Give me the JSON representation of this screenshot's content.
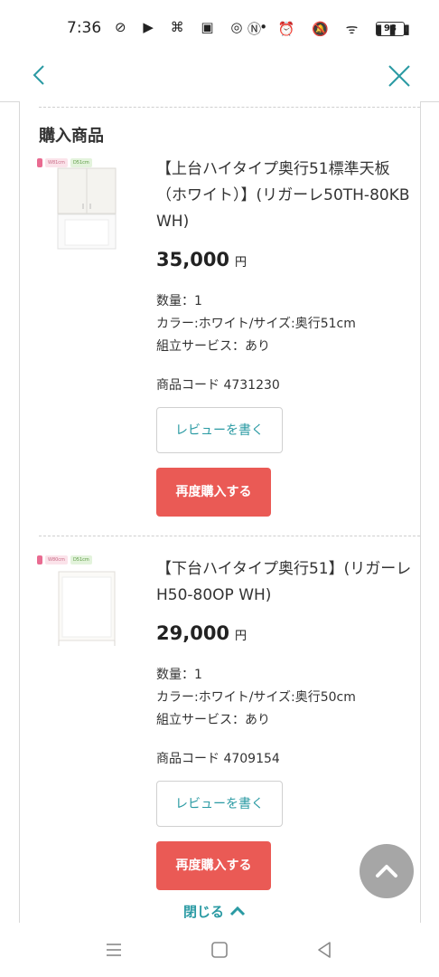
{
  "status_bar": {
    "time": "7:36",
    "left_icons": "⊘ ▶ ⌘ ▣ ◎ •",
    "right_icons": "Ⓝ ⏰ 🔕 ᯤ ▮▮▮",
    "battery": "98"
  },
  "nav": {
    "back_icon": "chevron-left-icon",
    "close_icon": "close-icon"
  },
  "section": {
    "title": "購入商品"
  },
  "products": [
    {
      "badges": [
        "",
        "W81cm",
        "D51cm"
      ],
      "name": "【上台ハイタイプ奥行51標準天板（ホワイト）】(リガーレ50TH-80KB WH)",
      "price": "35,000",
      "yen": "円",
      "qty": "数量：1",
      "color_size": "カラー:ホワイト/サイズ:奥行51cm",
      "assembly": "組立サービス：あり",
      "code": "商品コード 4731230",
      "review_label": "レビューを書く",
      "rebuy_label": "再度購入する"
    },
    {
      "badges": [
        "",
        "W80cm",
        "D51cm"
      ],
      "name": "【下台ハイタイプ奥行51】(リガーレ H50-80OP WH)",
      "price": "29,000",
      "yen": "円",
      "qty": "数量：1",
      "color_size": "カラー:ホワイト/サイズ:奥行50cm",
      "assembly": "組立サービス：あり",
      "code": "商品コード 4709154",
      "review_label": "レビューを書く",
      "rebuy_label": "再度購入する"
    }
  ],
  "footer": {
    "close_label": "閉じる"
  },
  "colors": {
    "accent": "#2a9aa3",
    "rebuy": "#ea5a55"
  }
}
